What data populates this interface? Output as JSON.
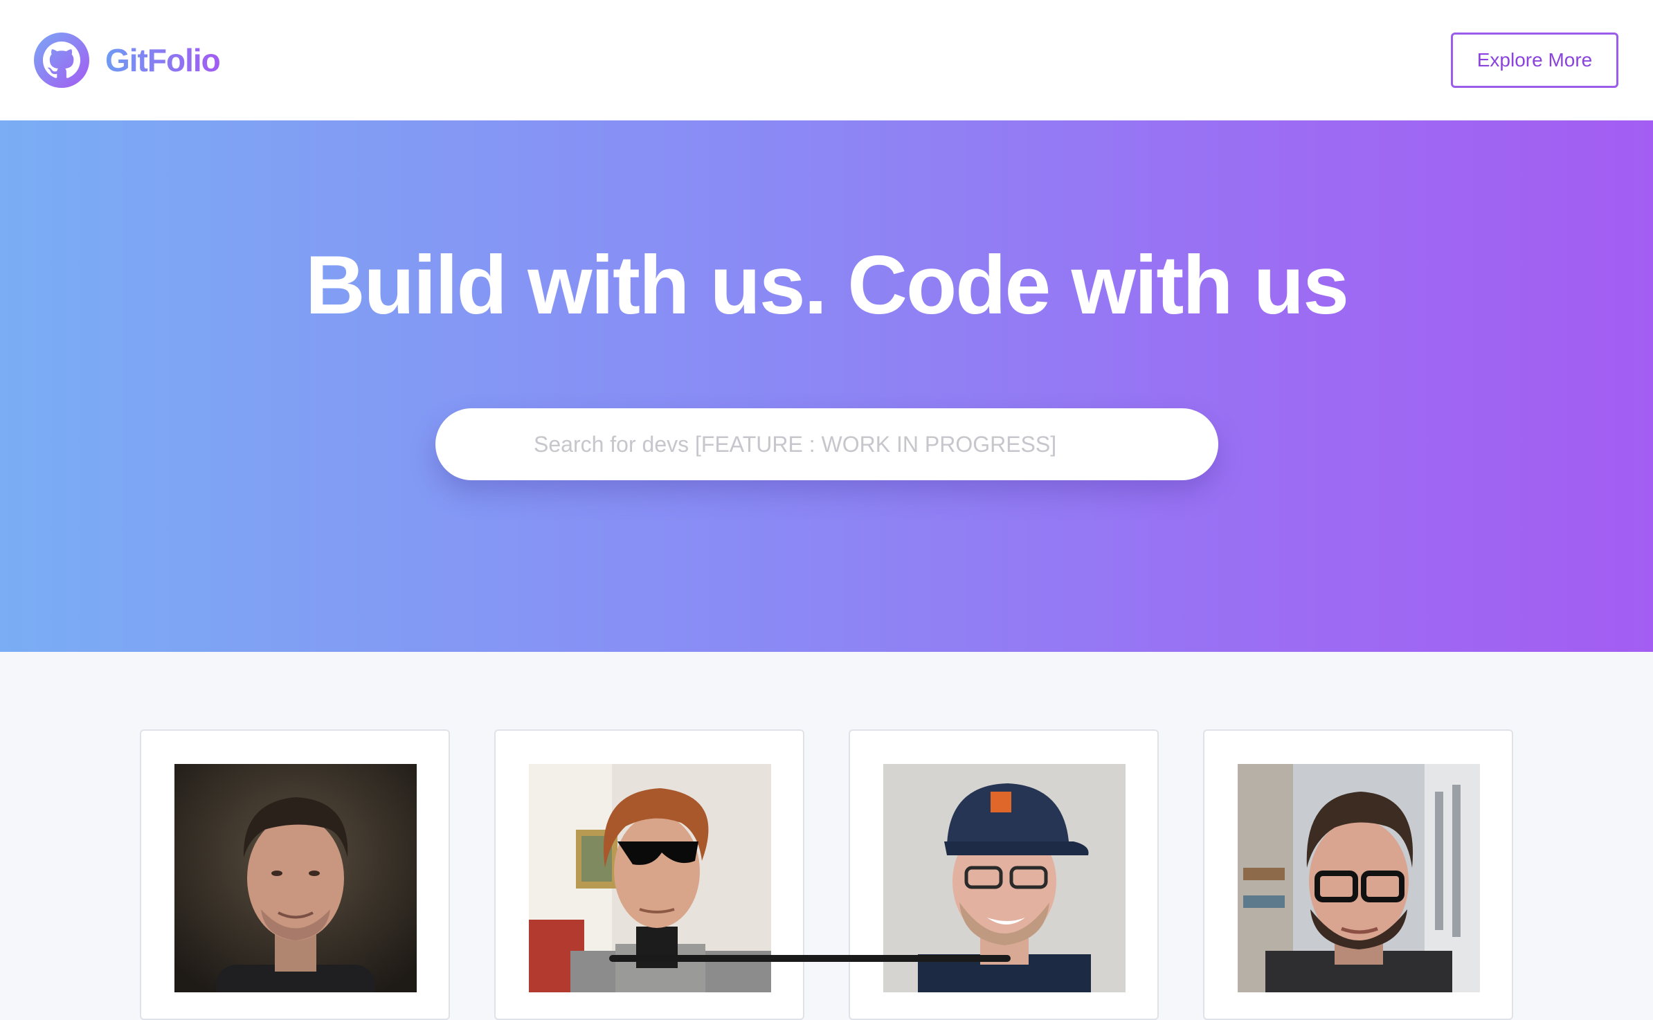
{
  "navbar": {
    "logo_icon": "github-octocat-icon",
    "brand_name": "GitFolio",
    "explore_label": "Explore More"
  },
  "hero": {
    "title": "Build with us. Code with us",
    "search_placeholder": "Search for devs [FEATURE : WORK IN PROGRESS]"
  },
  "colors": {
    "accent": "#9b5de9",
    "gradient_start": "#7aadf4",
    "gradient_end": "#a35df2",
    "background": "#f5f7fb"
  },
  "developers": [
    {
      "photo": "developer-photo"
    },
    {
      "photo": "developer-photo"
    },
    {
      "photo": "developer-photo"
    },
    {
      "photo": "developer-photo"
    }
  ]
}
